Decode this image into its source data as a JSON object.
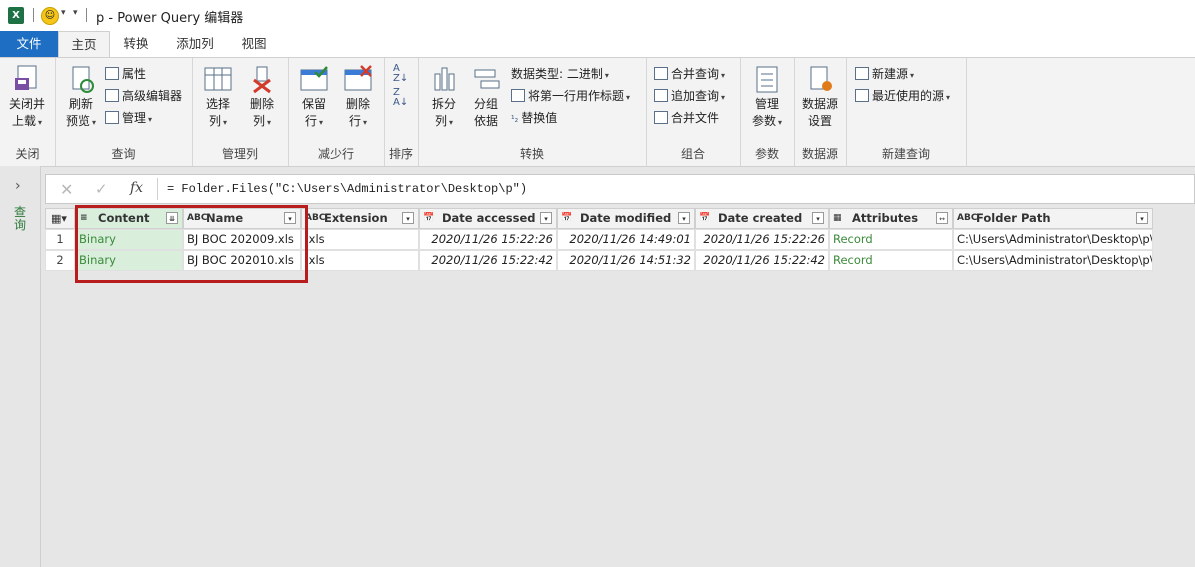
{
  "window": {
    "title": "p - Power Query 编辑器",
    "app_badge": "X"
  },
  "tabs": [
    "文件",
    "主页",
    "转换",
    "添加列",
    "视图"
  ],
  "ribbon": {
    "close": {
      "button": [
        "关闭并",
        "上载"
      ],
      "group": "关闭"
    },
    "query": {
      "refresh": [
        "刷新",
        "预览"
      ],
      "properties": "属性",
      "advanced_editor": "高级编辑器",
      "manage": "管理",
      "group": "查询"
    },
    "manage_cols": {
      "choose": [
        "选择",
        "列"
      ],
      "remove": [
        "删除",
        "列"
      ],
      "group": "管理列"
    },
    "reduce_rows": {
      "keep": [
        "保留",
        "行"
      ],
      "remove": [
        "删除",
        "行"
      ],
      "group": "减少行"
    },
    "sort": {
      "group": "排序"
    },
    "transform": {
      "split": [
        "拆分",
        "列"
      ],
      "group_by": [
        "分组",
        "依据"
      ],
      "data_type": "数据类型: 二进制",
      "first_row_headers": "将第一行用作标题",
      "replace": "替换值",
      "group": "转换"
    },
    "combine": {
      "merge": "合并查询",
      "append": "追加查询",
      "combine_files": "合并文件",
      "group": "组合"
    },
    "params": {
      "manage": [
        "管理",
        "参数"
      ],
      "group": "参数"
    },
    "datasource": {
      "settings": [
        "数据源",
        "设置"
      ],
      "group": "数据源"
    },
    "newquery": {
      "new_source": "新建源",
      "recent": "最近使用的源",
      "group": "新建查询"
    }
  },
  "formula_bar": {
    "fx": "fx",
    "formula": "= Folder.Files(\"C:\\Users\\Administrator\\Desktop\\p\")"
  },
  "left_pane": {
    "label": "查询"
  },
  "table": {
    "columns": [
      {
        "type": "≡",
        "name": "Content"
      },
      {
        "type": "ABC",
        "name": "Name"
      },
      {
        "type": "ABC",
        "name": "Extension"
      },
      {
        "type": "📅",
        "name": "Date accessed"
      },
      {
        "type": "📅",
        "name": "Date modified"
      },
      {
        "type": "📅",
        "name": "Date created"
      },
      {
        "type": "▦",
        "name": "Attributes"
      },
      {
        "type": "ABC",
        "name": "Folder Path"
      }
    ],
    "rows": [
      {
        "n": "1",
        "content": "Binary",
        "name": "BJ BOC 202009.xls",
        "ext": ".xls",
        "accessed": "2020/11/26 15:22:26",
        "modified": "2020/11/26 14:49:01",
        "created": "2020/11/26 15:22:26",
        "attr": "Record",
        "path": "C:\\Users\\Administrator\\Desktop\\p\\"
      },
      {
        "n": "2",
        "content": "Binary",
        "name": "BJ BOC 202010.xls",
        "ext": ".xls",
        "accessed": "2020/11/26 15:22:42",
        "modified": "2020/11/26 14:51:32",
        "created": "2020/11/26 15:22:42",
        "attr": "Record",
        "path": "C:\\Users\\Administrator\\Desktop\\p\\"
      }
    ]
  }
}
